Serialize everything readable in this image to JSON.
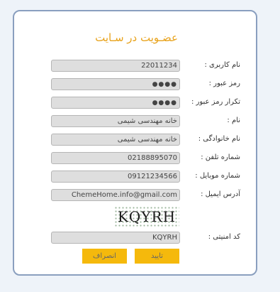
{
  "form": {
    "title": "عضـویت در سـایت",
    "fields": [
      {
        "label": "نام کاربری :",
        "value": "22011234",
        "type": "text"
      },
      {
        "label": "رمز عبور :",
        "value": "●●●●",
        "type": "password"
      },
      {
        "label": "تکرار رمز عبور :",
        "value": "●●●●",
        "type": "password"
      },
      {
        "label": "نام :",
        "value": "خانه مهندسی شیمی",
        "type": "text"
      },
      {
        "label": "نام خانوادگی :",
        "value": "خانه مهندسی شیمی",
        "type": "text"
      },
      {
        "label": "شماره تلفن :",
        "value": "02188895070",
        "type": "text"
      },
      {
        "label": "شماره موبایل :",
        "value": "09121234566",
        "type": "text"
      },
      {
        "label": "آدرس ایمیل :",
        "value": "ChemeHome.info@gmail.com",
        "type": "text"
      }
    ],
    "captcha": {
      "image_text": "KQYRH"
    },
    "security_code": {
      "label": "کد امنیتی :",
      "value": "KQYRH"
    },
    "buttons": {
      "submit": "تایید",
      "cancel": "انصراف"
    }
  }
}
